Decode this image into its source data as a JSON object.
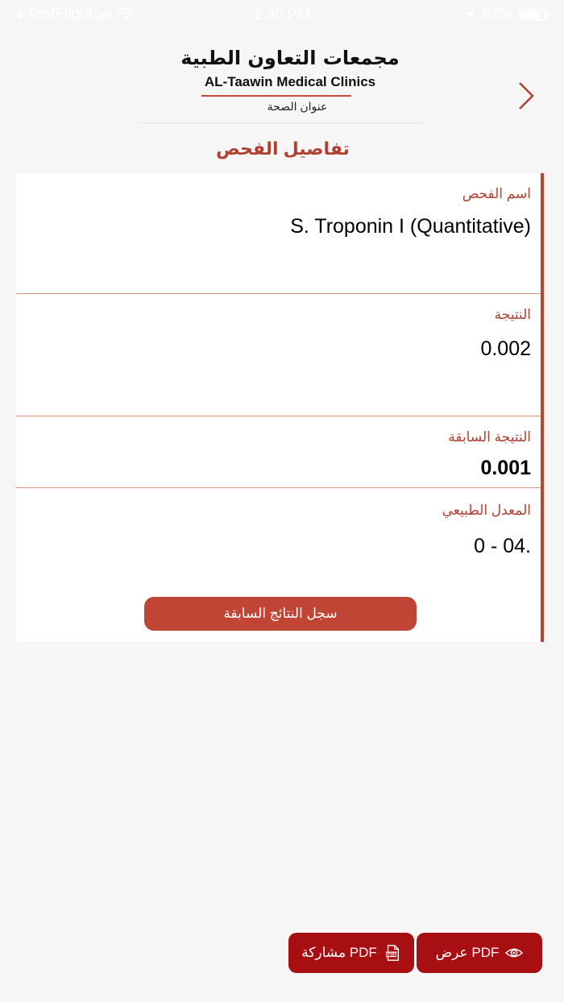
{
  "status_bar": {
    "carrier": "TestFlight",
    "time": "1:30 PM",
    "battery": "82%",
    "battery_level": 0.82
  },
  "header": {
    "logo_arabic": "مجمعات التعاون الطبية",
    "logo_english": "AL-Taawin Medical Clinics",
    "tagline": "عنوان الصحة"
  },
  "page": {
    "title": "تفاصيل الفحص"
  },
  "details": {
    "test_name_label": "اسم الفحص",
    "test_name_value": "S. Troponin I (Quantitative)",
    "result_label": "النتيجة",
    "result_value": "0.002",
    "previous_result_label": "النتيجة السابقة",
    "previous_result_value": "0.001",
    "normal_range_label": "المعدل الطبيعي",
    "normal_range_value": "0 - 04."
  },
  "actions": {
    "history_button": "سجل النتائج السابقة",
    "view_pdf_button": "عرض PDF",
    "share_pdf_button": "مشاركة PDF"
  },
  "colors": {
    "accent": "#b0402f",
    "button": "#c04535",
    "bottom_button": "#a80f12"
  }
}
